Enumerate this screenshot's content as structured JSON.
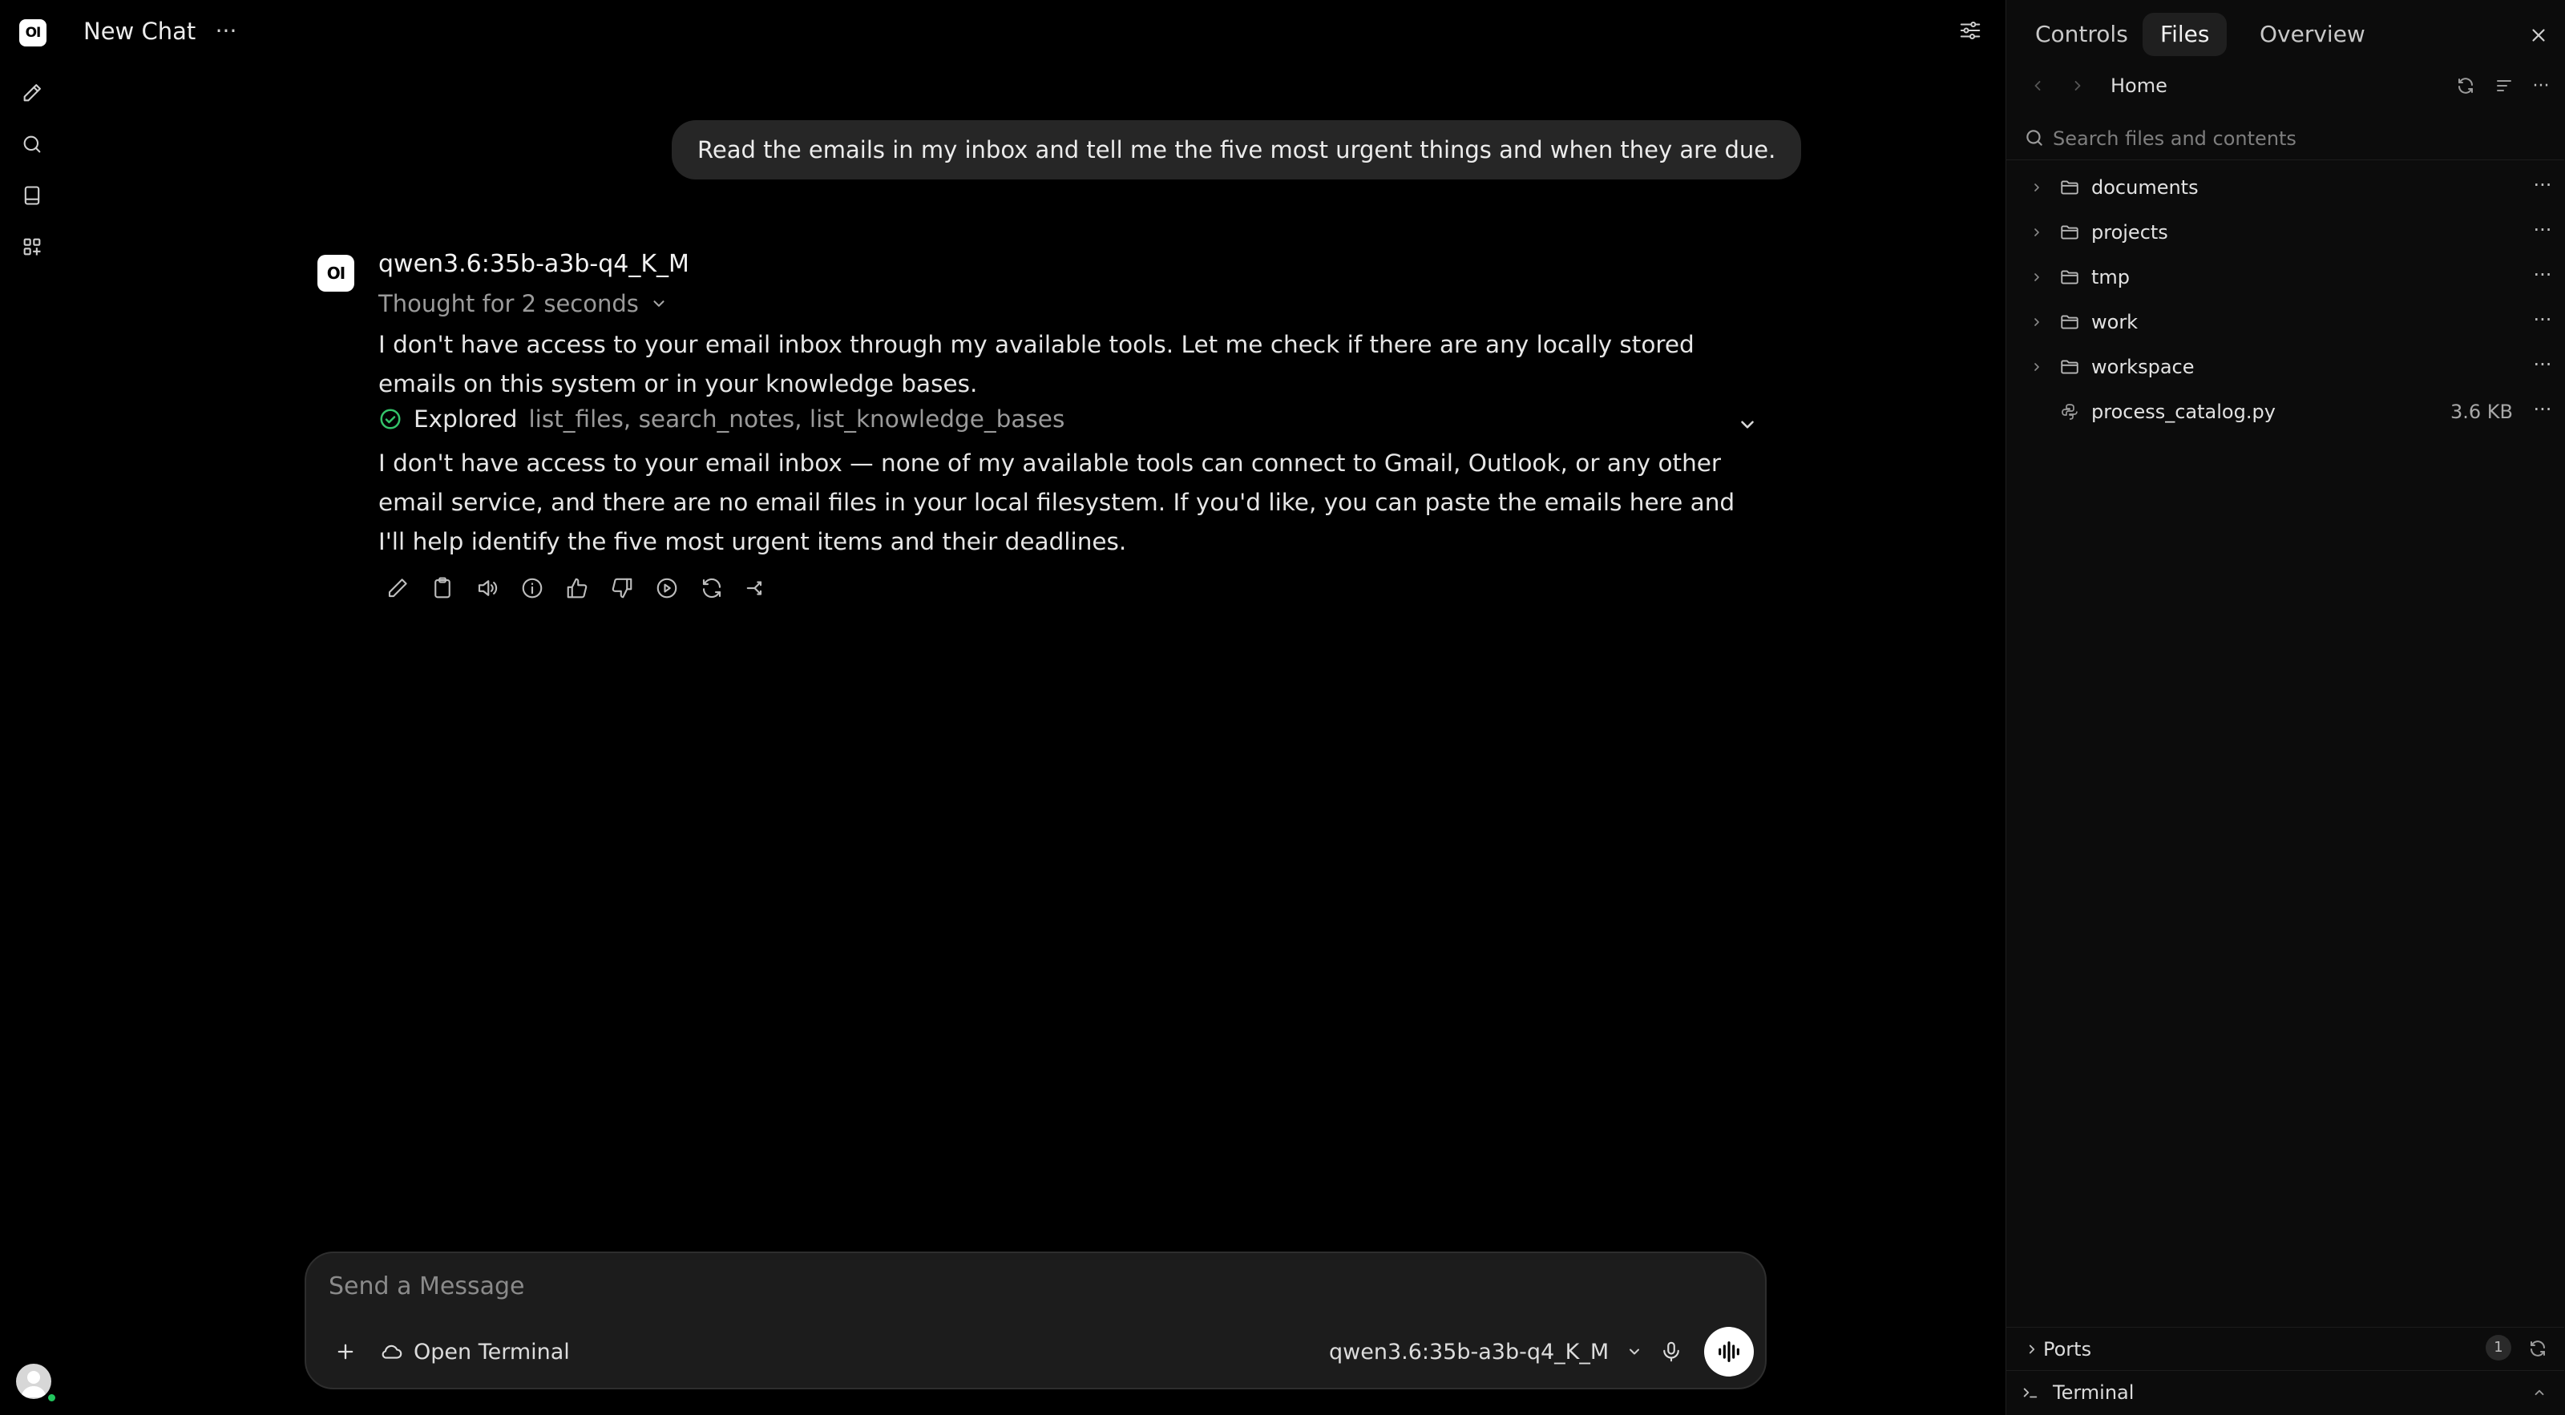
{
  "app": {
    "logo_text": "OI",
    "chat_title": "New Chat",
    "more_label": "···"
  },
  "sidebar": {
    "icons": [
      "new-chat-icon",
      "search-icon",
      "notes-icon",
      "apps-icon"
    ]
  },
  "conversation": {
    "user_message": "Read the emails in my inbox and tell me the five most urgent things and when they are due.",
    "assistant": {
      "avatar_text": "OI",
      "model": "qwen3.6:35b-a3b-q4_K_M",
      "thought": "Thought for 2 seconds",
      "paragraph_1": "I don't have access to your email inbox through my available tools. Let me check if there are any locally stored emails on this system or in your knowledge bases.",
      "explored_label": "Explored",
      "explored_tools": "list_files, search_notes, list_knowledge_bases",
      "paragraph_2": "I don't have access to your email inbox — none of my available tools can connect to Gmail, Outlook, or any other email service, and there are no email files in your local filesystem. If you'd like, you can paste the emails here and I'll help identify the five most urgent items and their deadlines."
    },
    "actions": [
      "edit-icon",
      "copy-icon",
      "read-aloud-icon",
      "info-icon",
      "thumbs-up-icon",
      "thumbs-down-icon",
      "continue-icon",
      "regenerate-icon",
      "branch-icon"
    ]
  },
  "composer": {
    "placeholder": "Send a Message",
    "terminal_label": "Open Terminal",
    "model": "qwen3.6:35b-a3b-q4_K_M"
  },
  "panel": {
    "tabs": [
      {
        "label": "Controls",
        "active": false
      },
      {
        "label": "Files",
        "active": true
      },
      {
        "label": "Overview",
        "active": false
      }
    ],
    "breadcrumb": "Home",
    "search_placeholder": "Search files and contents",
    "files": [
      {
        "name": "documents",
        "type": "folder",
        "size": ""
      },
      {
        "name": "projects",
        "type": "folder",
        "size": ""
      },
      {
        "name": "tmp",
        "type": "folder",
        "size": ""
      },
      {
        "name": "work",
        "type": "folder",
        "size": ""
      },
      {
        "name": "workspace",
        "type": "folder",
        "size": ""
      },
      {
        "name": "process_catalog.py",
        "type": "file",
        "size": "3.6 KB"
      }
    ],
    "ports_label": "Ports",
    "ports_count": "1",
    "terminal_label": "Terminal"
  }
}
